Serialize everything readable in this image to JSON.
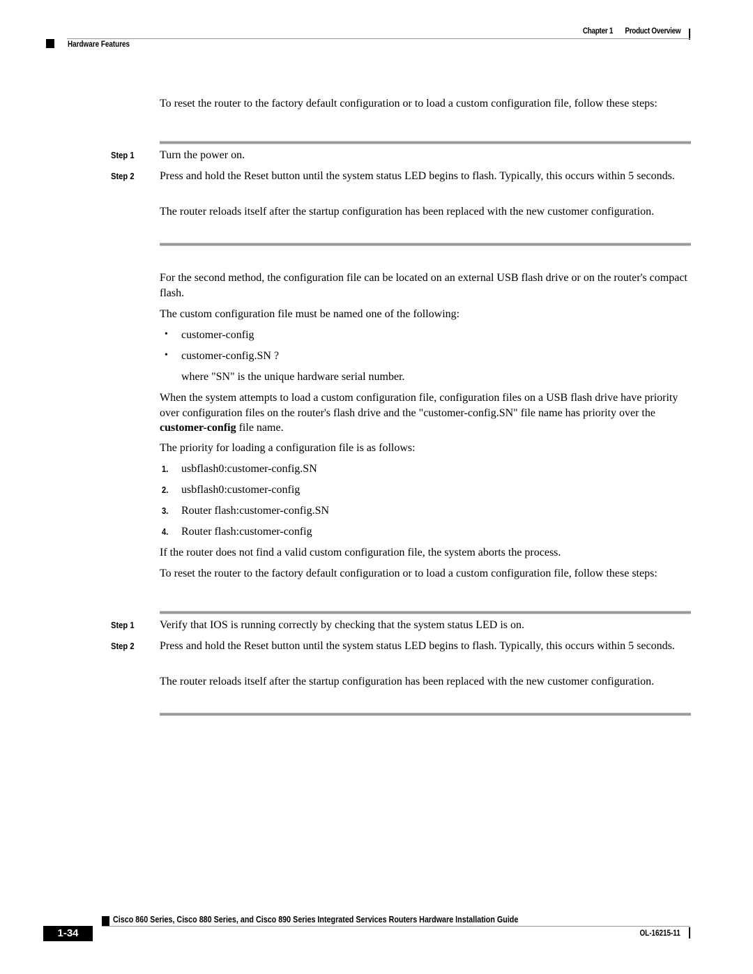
{
  "header": {
    "chapter": "Chapter 1",
    "chapter_title": "Product Overview",
    "section": "Hardware Features"
  },
  "method1": {
    "intro": "To reset the router to the factory default configuration or to load a custom configuration file, follow these steps:",
    "steps": [
      {
        "label": "Step 1",
        "text": "Turn the power on."
      },
      {
        "label": "Step 2",
        "text": "Press and hold the Reset button until the system status LED begins to flash. Typically, this occurs within 5 seconds.",
        "note": "The router reloads itself after the startup configuration has been replaced with the new customer configuration."
      }
    ]
  },
  "method2": {
    "intro": "For the second method, the configuration file can be located on an external USB flash drive or on the router's compact flash.",
    "naming_intro": "The custom configuration file must be named one of the following:",
    "bullet_glyph": "•",
    "names": [
      "customer-config",
      "customer-config.SN ?"
    ],
    "sn_note": "where \"SN\" is the unique hardware serial number.",
    "priority_text_before": "When the system attempts to load a custom configuration file, configuration files on a USB flash drive have priority over configuration files on the router's flash drive and the \"customer-config.SN\" file name has priority over the ",
    "priority_text_bold": "customer-config",
    "priority_text_after": " file name.",
    "priority_intro": "The priority for loading a configuration file is as follows:",
    "priority_list": [
      {
        "num": "1.",
        "text": "usbflash0:customer-config.SN"
      },
      {
        "num": "2.",
        "text": "usbflash0:customer-config"
      },
      {
        "num": "3.",
        "text": "Router flash:customer-config.SN"
      },
      {
        "num": "4.",
        "text": "Router flash:customer-config"
      }
    ],
    "abort_note": "If the router does not find a valid custom configuration file, the system aborts the process.",
    "intro2": "To reset the router to the factory default configuration or to load a custom configuration file, follow these steps:",
    "steps": [
      {
        "label": "Step 1",
        "text": "Verify that IOS is running correctly by checking that the system status LED is on."
      },
      {
        "label": "Step 2",
        "text": "Press and hold the Reset button until the system status LED begins to flash. Typically, this occurs within 5 seconds.",
        "note": "The router reloads itself after the startup configuration has been replaced with the new customer configuration."
      }
    ]
  },
  "footer": {
    "guide_title": "Cisco 860 Series, Cisco 880 Series, and Cisco 890 Series Integrated Services Routers Hardware Installation Guide",
    "page_number": "1-34",
    "doc_number": "OL-16215-11"
  }
}
